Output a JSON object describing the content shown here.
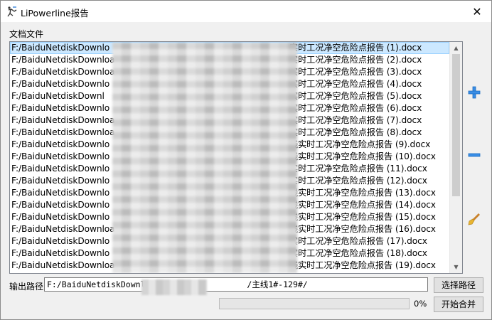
{
  "window": {
    "title": "LiPowerline报告",
    "close_glyph": "✕"
  },
  "docs_label": "文档文件",
  "files": [
    {
      "left": "F:/BaiduNetdiskDownlo",
      "right": "实时工况净空危险点报告 (1).docx"
    },
    {
      "left": "F:/BaiduNetdiskDownloa",
      "right": "实时工况净空危险点报告 (2).docx"
    },
    {
      "left": "F:/BaiduNetdiskDownloa",
      "right": "实时工况净空危险点报告 (3).docx"
    },
    {
      "left": "F:/BaiduNetdiskDownlo",
      "right": "实时工况净空危险点报告 (4).docx"
    },
    {
      "left": "F:/BaiduNetdiskDownl",
      "right": "实时工况净空危险点报告 (5).docx"
    },
    {
      "left": "F:/BaiduNetdiskDownlo",
      "right": "实时工况净空危险点报告 (6).docx"
    },
    {
      "left": "F:/BaiduNetdiskDownloa",
      "right": "实时工况净空危险点报告 (7).docx"
    },
    {
      "left": "F:/BaiduNetdiskDownloa",
      "right": "实时工况净空危险点报告 (8).docx"
    },
    {
      "left": "F:/BaiduNetdiskDownlo",
      "right": "线实时工况净空危险点报告 (9).docx"
    },
    {
      "left": "F:/BaiduNetdiskDownlo",
      "right": "线实时工况净空危险点报告 (10).docx"
    },
    {
      "left": "F:/BaiduNetdiskDownlo",
      "right": "实时工况净空危险点报告 (11).docx"
    },
    {
      "left": "F:/BaiduNetdiskDownlo",
      "right": "实时工况净空危险点报告 (12).docx"
    },
    {
      "left": "F:/BaiduNetdiskDownlo",
      "right": "线实时工况净空危险点报告 (13).docx"
    },
    {
      "left": "F:/BaiduNetdiskDownlo",
      "right": "线实时工况净空危险点报告 (14).docx"
    },
    {
      "left": "F:/BaiduNetdiskDownlo",
      "right": "线实时工况净空危险点报告 (15).docx"
    },
    {
      "left": "F:/BaiduNetdiskDownloa",
      "right": "线实时工况净空危险点报告 (16).docx"
    },
    {
      "left": "F:/BaiduNetdiskDownlo",
      "right": "实时工况净空危险点报告 (17).docx"
    },
    {
      "left": "F:/BaiduNetdiskDownlo",
      "right": "实时工况净空危险点报告 (18).docx"
    },
    {
      "left": "F:/BaiduNetdiskDownload/",
      "right": "线实时工况净空危险点报告 (19).docx"
    }
  ],
  "selected_index": 0,
  "output": {
    "label": "输出路径",
    "path_prefix": "F:/BaiduNetdiskDownlo",
    "path_suffix": "/主线1#-129#/",
    "choose_button": "选择路径"
  },
  "progress": {
    "value": 0,
    "text": "0%"
  },
  "merge_button": "开始合并",
  "icons": {
    "add": "plus-icon",
    "remove": "minus-icon",
    "clear": "brush-icon",
    "app": "app-icon"
  },
  "colors": {
    "selection": "#cce8ff",
    "add_remove_blue": "#3a8ee6",
    "brush_yellow": "#e8b530"
  }
}
